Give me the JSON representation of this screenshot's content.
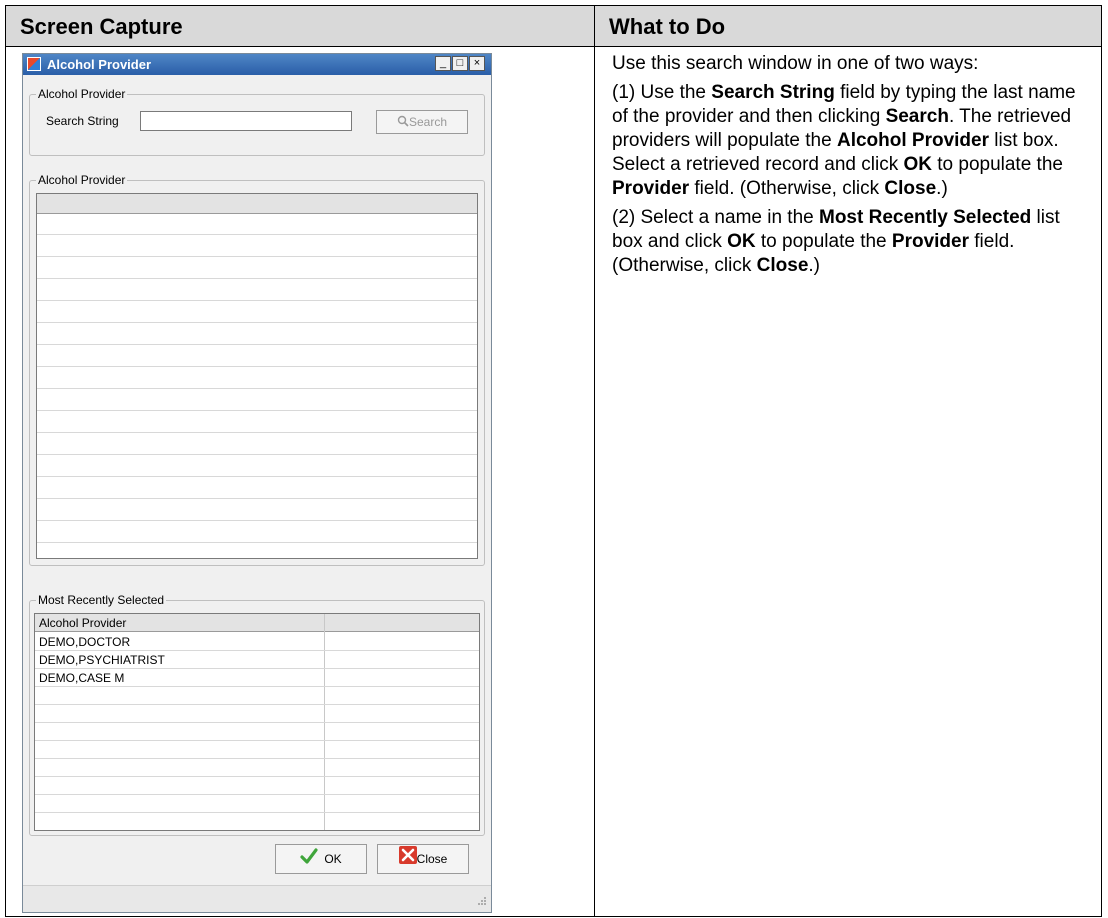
{
  "table": {
    "col1_header": "Screen Capture",
    "col2_header": "What to Do"
  },
  "window": {
    "title": "Alcohol Provider",
    "controls": {
      "minimize": "_",
      "maximize": "□",
      "close": "×"
    },
    "search_group": {
      "label": "Alcohol Provider",
      "field_label": "Search String",
      "field_value": "",
      "search_button": "Search"
    },
    "results_group": {
      "label": "Alcohol Provider"
    },
    "recent_group": {
      "label": "Most Recently Selected",
      "column_header": "Alcohol Provider",
      "rows": [
        "DEMO,DOCTOR",
        "DEMO,PSYCHIATRIST",
        "DEMO,CASE M"
      ]
    },
    "ok_button": "OK",
    "close_button": "Close"
  },
  "instructions": {
    "p1": "Use this search window in one of two ways:",
    "p2": [
      {
        "t": "(1) Use the ",
        "b": false
      },
      {
        "t": "Search String",
        "b": true
      },
      {
        "t": " field by typing the last name of the provider and then clicking ",
        "b": false
      },
      {
        "t": "Search",
        "b": true
      },
      {
        "t": ". The retrieved providers will populate the ",
        "b": false
      },
      {
        "t": "Alcohol Provider",
        "b": true
      },
      {
        "t": " list box. Select a retrieved record and click ",
        "b": false
      },
      {
        "t": "OK",
        "b": true
      },
      {
        "t": " to populate the ",
        "b": false
      },
      {
        "t": "Provider",
        "b": true
      },
      {
        "t": " field. (Otherwise, click ",
        "b": false
      },
      {
        "t": "Close",
        "b": true
      },
      {
        "t": ".)",
        "b": false
      }
    ],
    "p3": [
      {
        "t": "(2) Select a name in the ",
        "b": false
      },
      {
        "t": "Most Recently Selected",
        "b": true
      },
      {
        "t": " list box and click ",
        "b": false
      },
      {
        "t": "OK",
        "b": true
      },
      {
        "t": " to populate the ",
        "b": false
      },
      {
        "t": "Provider",
        "b": true
      },
      {
        "t": " field. (Otherwise, click ",
        "b": false
      },
      {
        "t": "Close",
        "b": true
      },
      {
        "t": ".)",
        "b": false
      }
    ]
  }
}
